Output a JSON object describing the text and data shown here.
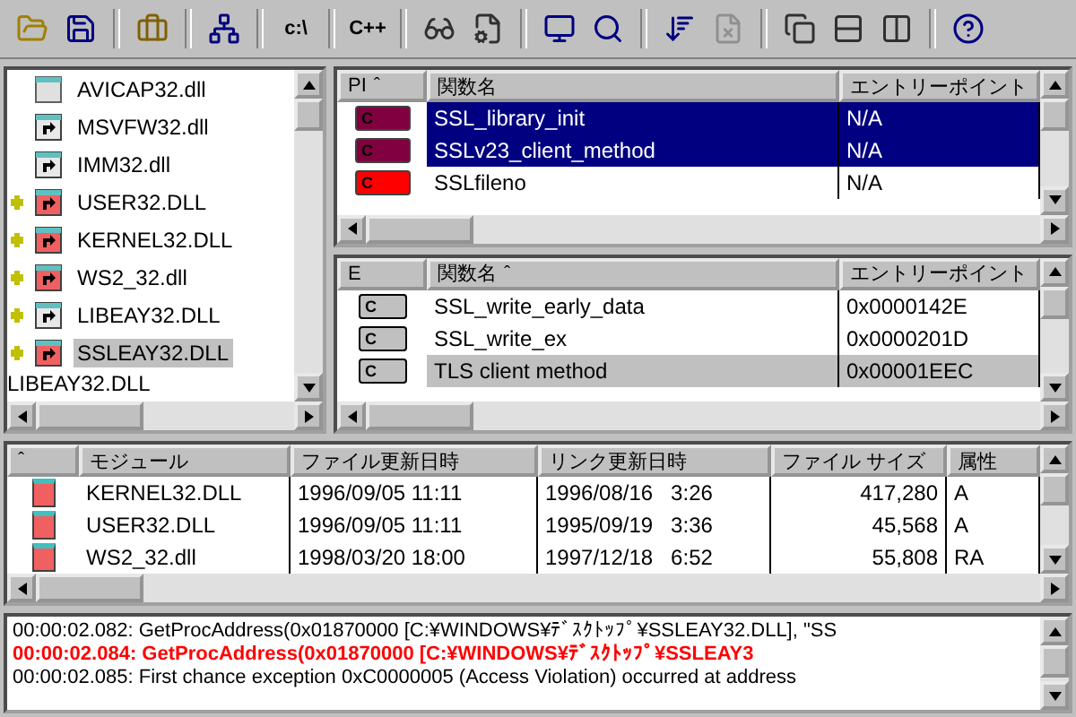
{
  "toolbar": [
    {
      "kind": "icon"
    },
    {
      "kind": "icon"
    },
    {
      "kind": "sep"
    },
    {
      "kind": "icon"
    },
    {
      "kind": "sep"
    },
    {
      "kind": "icon"
    },
    {
      "kind": "sep"
    },
    {
      "kind": "text",
      "label": "c:\\"
    },
    {
      "kind": "sep"
    },
    {
      "kind": "text",
      "label": "C++"
    },
    {
      "kind": "sep"
    },
    {
      "kind": "icon"
    },
    {
      "kind": "icon"
    },
    {
      "kind": "sep"
    },
    {
      "kind": "icon"
    },
    {
      "kind": "icon"
    },
    {
      "kind": "sep"
    },
    {
      "kind": "icon",
      "disabled": false
    },
    {
      "kind": "icon",
      "disabled": true
    },
    {
      "kind": "sep"
    },
    {
      "kind": "icon"
    },
    {
      "kind": "icon"
    },
    {
      "kind": "icon"
    },
    {
      "kind": "sep"
    },
    {
      "kind": "icon"
    }
  ],
  "tree": {
    "items": [
      {
        "name": "AVICAP32.dll",
        "kind": "blank",
        "warning": false,
        "selected": false
      },
      {
        "name": "MSVFW32.dll",
        "kind": "module",
        "warning": false,
        "selected": false
      },
      {
        "name": "IMM32.dll",
        "kind": "module",
        "warning": false,
        "selected": false
      },
      {
        "name": "USER32.DLL",
        "kind": "module-red",
        "warning": true,
        "selected": false
      },
      {
        "name": "KERNEL32.DLL",
        "kind": "module-red",
        "warning": true,
        "selected": false
      },
      {
        "name": "WS2_32.dll",
        "kind": "module-red",
        "warning": true,
        "selected": false
      },
      {
        "name": "LIBEAY32.DLL",
        "kind": "module",
        "warning": true,
        "selected": false
      },
      {
        "name": "SSLEAY32.DLL",
        "kind": "module-red",
        "warning": true,
        "selected": true
      }
    ],
    "drag_label": "LIBEAY32.DLL"
  },
  "imports": {
    "columns": [
      {
        "label": "PI",
        "sort": "ˆ"
      },
      {
        "label": "関数名"
      },
      {
        "label": "エントリーポイント"
      }
    ],
    "rows": [
      {
        "badge": "C",
        "color": "#800040",
        "name": "SSL_library_init",
        "entry": "N/A",
        "selected": true
      },
      {
        "badge": "C",
        "color": "#800040",
        "name": "SSLv23_client_method",
        "entry": "N/A",
        "selected": true
      },
      {
        "badge": "C",
        "color": "#ff0000",
        "name": "SSLfileno",
        "entry": "N/A",
        "selected": false
      }
    ]
  },
  "exports": {
    "columns": [
      {
        "label": "E"
      },
      {
        "label": "関数名",
        "sort": "ˆ"
      },
      {
        "label": "エントリーポイント"
      }
    ],
    "rows": [
      {
        "badge": "C",
        "name": "SSL_write_early_data",
        "entry": "0x0000142E",
        "selected": false
      },
      {
        "badge": "C",
        "name": "SSL_write_ex",
        "entry": "0x0000201D",
        "selected": false
      },
      {
        "badge": "C",
        "name": "TLS client method",
        "entry": "0x00001EEC",
        "selected": true
      }
    ]
  },
  "modules": {
    "columns": [
      "ˆ",
      "モジュール",
      "ファイル更新日時",
      "リンク更新日時",
      "ファイル サイズ",
      "属性"
    ],
    "rows": [
      {
        "module": "KERNEL32.DLL",
        "file_time": "1996/09/05 11:11",
        "link_time": "1996/08/16   3:26",
        "size": "417,280",
        "attr": "A"
      },
      {
        "module": "USER32.DLL",
        "file_time": "1996/09/05 11:11",
        "link_time": "1995/09/19   3:36",
        "size": "45,568",
        "attr": "A"
      },
      {
        "module": "WS2_32.dll",
        "file_time": "1998/03/20 18:00",
        "link_time": "1997/12/18   6:52",
        "size": "55,808",
        "attr": "RA"
      }
    ]
  },
  "log": [
    {
      "time": "00:00:02.082:",
      "text": "GetProcAddress(0x01870000 [C:¥WINDOWS¥ﾃﾞｽｸﾄｯﾌﾟ¥SSLEAY32.DLL], \"SS",
      "kind": "normal"
    },
    {
      "time": "00:00:02.084:",
      "text": "GetProcAddress(0x01870000 [C:¥WINDOWS¥ﾃﾞｽｸﾄｯﾌﾟ¥SSLEAY3",
      "kind": "error"
    },
    {
      "time": "00:00:02.085:",
      "text": "First chance exception 0xC0000005 (Access Violation) occurred at address",
      "kind": "normal"
    }
  ]
}
